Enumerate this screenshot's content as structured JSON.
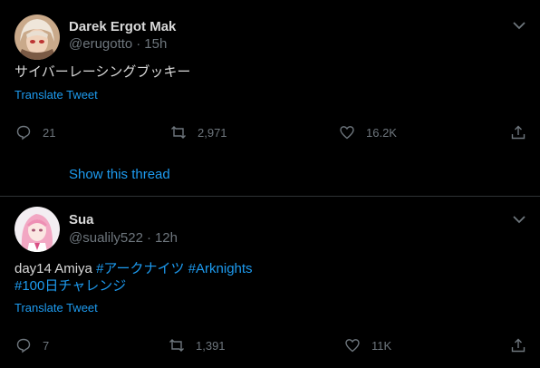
{
  "tweets": [
    {
      "name": "Darek Ergot Mak",
      "handle": "@erugotto",
      "sep": "·",
      "time": "15h",
      "text": "サイバーレーシングブッキー",
      "translate": "Translate Tweet",
      "replies": "21",
      "retweets": "2,971",
      "likes": "16.2K",
      "show_thread": "Show this thread"
    },
    {
      "name": "Sua",
      "handle": "@sualily522",
      "sep": "·",
      "time": "12h",
      "text_prefix": "day14 Amiya ",
      "hashtag1": "#アークナイツ",
      "hashtag2": "#Arknights",
      "hashtag3": "#100日チャレンジ",
      "translate": "Translate Tweet",
      "replies": "7",
      "retweets": "1,391",
      "likes": "11K"
    }
  ],
  "colors": {
    "background": "#000000",
    "accent": "#1d9bf0",
    "muted": "#6e767d",
    "divider": "#2f3336"
  }
}
